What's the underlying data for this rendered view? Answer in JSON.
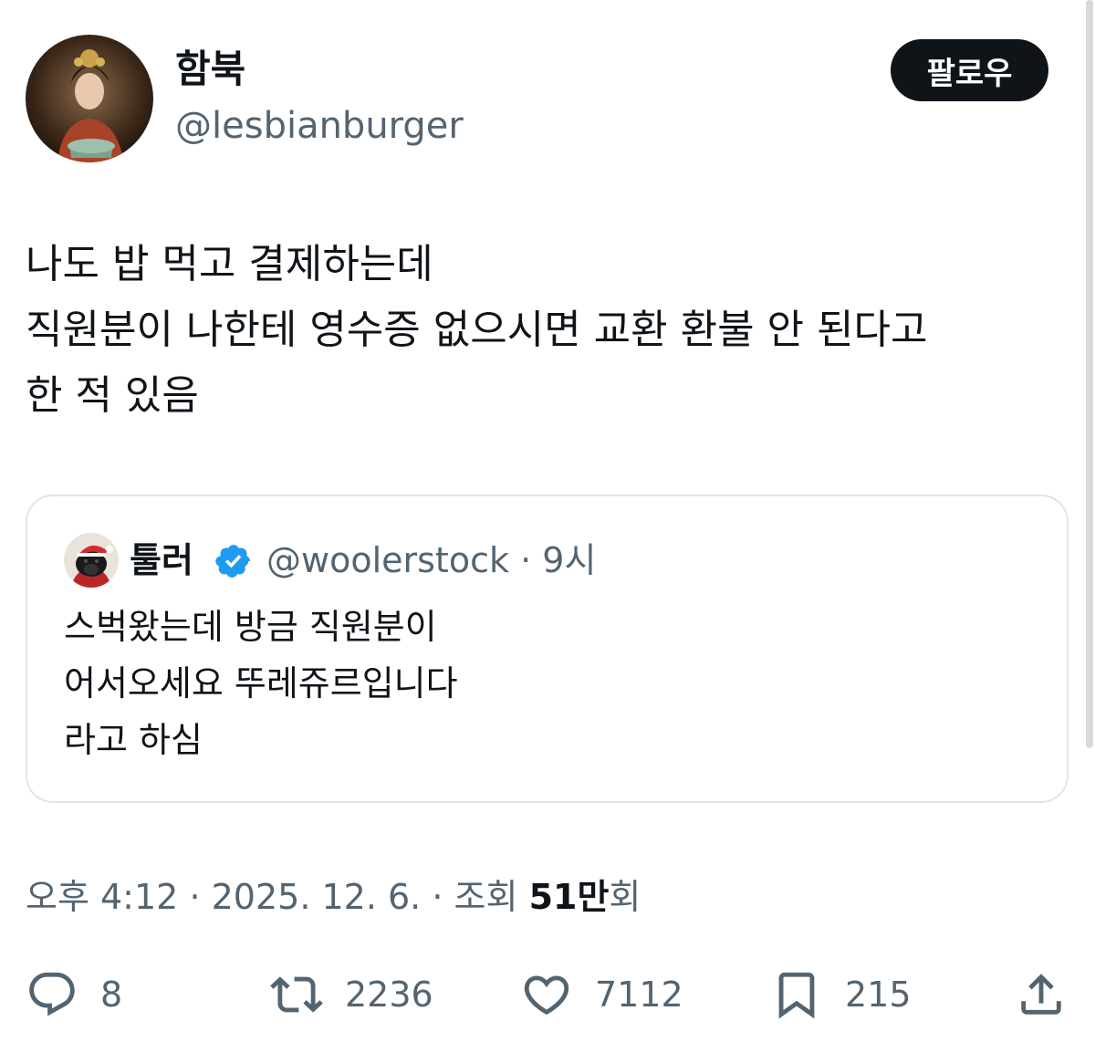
{
  "author": {
    "display_name": "함북",
    "handle": "@lesbianburger",
    "avatar_icon": "profile-photo-woman-traditional-costume"
  },
  "follow_button_label": "팔로우",
  "tweet": {
    "lines": [
      "나도 밥 먹고 결제하는데",
      "직원분이 나한테 영수증 없으시면 교환 환불 안 된다고",
      "한 적 있음"
    ]
  },
  "quoted_tweet": {
    "display_name": "툴러",
    "verified_icon": "verified-badge-icon",
    "handle": "@woolerstock",
    "separator": "·",
    "time": "9시",
    "avatar_icon": "profile-photo-dog-santa-hat",
    "lines": [
      "스벅왔는데 방금 직원분이",
      "어서오세요 뚜레쥬르입니다",
      "라고 하심"
    ]
  },
  "meta": {
    "time": "오후 4:12",
    "separator": "·",
    "date": "2025. 12. 6.",
    "views_prefix": "조회",
    "views_count": "51만",
    "views_suffix": "회"
  },
  "actions": {
    "reply_count": "8",
    "retweet_count": "2236",
    "like_count": "7112",
    "bookmark_count": "215"
  },
  "colors": {
    "text_primary": "#0f1419",
    "text_secondary": "#536471",
    "verified": "#1d9bf0",
    "border": "#e1e5e8"
  }
}
